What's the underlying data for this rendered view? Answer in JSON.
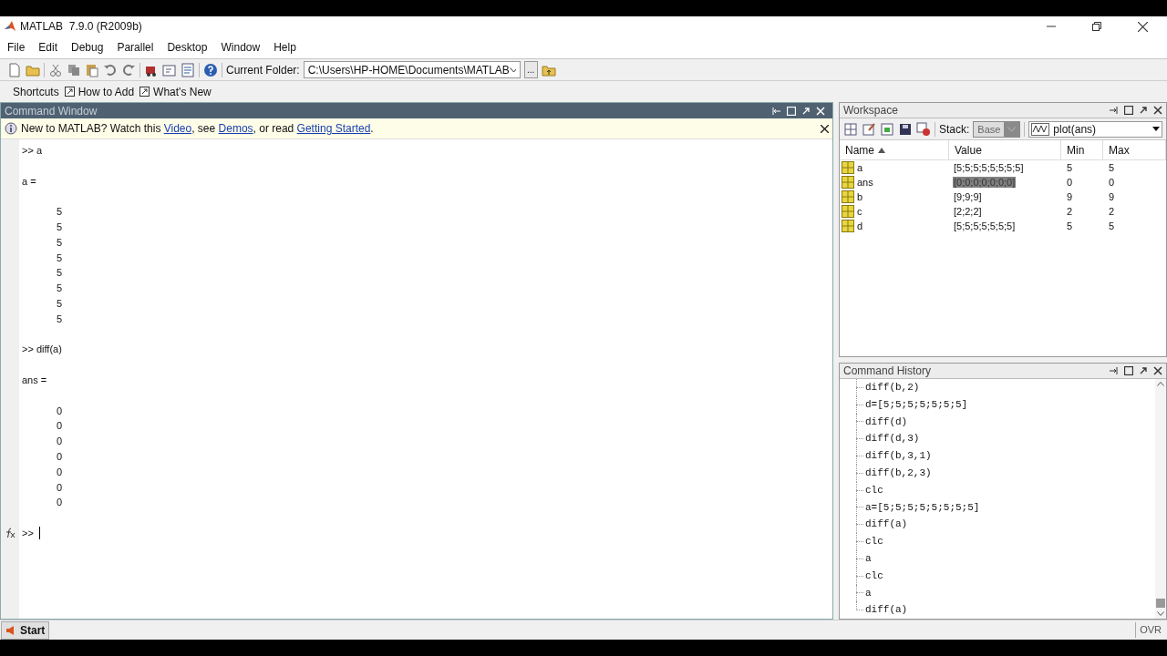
{
  "window": {
    "title": "MATLAB  7.9.0 (R2009b)"
  },
  "menu": [
    "File",
    "Edit",
    "Debug",
    "Parallel",
    "Desktop",
    "Window",
    "Help"
  ],
  "current_folder": {
    "label": "Current Folder:",
    "value": "C:\\Users\\HP-HOME\\Documents\\MATLAB",
    "browse": "..."
  },
  "shortcuts": [
    "Shortcuts",
    "How to Add",
    "What's New"
  ],
  "command_window": {
    "title": "Command Window",
    "banner": [
      {
        "kind": "text",
        "text": "New to MATLAB? Watch this "
      },
      {
        "kind": "link",
        "text": "Video"
      },
      {
        "kind": "text",
        "text": ", see "
      },
      {
        "kind": "link",
        "text": "Demos"
      },
      {
        "kind": "text",
        "text": ", or read "
      },
      {
        "kind": "link",
        "text": "Getting Started"
      },
      {
        "kind": "text",
        "text": "."
      }
    ],
    "lines": [
      {
        "kind": "command",
        "text": ">> a"
      },
      {
        "kind": "label",
        "text": "a ="
      },
      {
        "kind": "value",
        "text": "5"
      },
      {
        "kind": "value",
        "text": "5"
      },
      {
        "kind": "value",
        "text": "5"
      },
      {
        "kind": "value",
        "text": "5"
      },
      {
        "kind": "value",
        "text": "5"
      },
      {
        "kind": "value",
        "text": "5"
      },
      {
        "kind": "value",
        "text": "5"
      },
      {
        "kind": "value",
        "text": "5"
      },
      {
        "kind": "command",
        "text": ">> diff(a)"
      },
      {
        "kind": "label",
        "text": "ans ="
      },
      {
        "kind": "value",
        "text": "0"
      },
      {
        "kind": "value",
        "text": "0"
      },
      {
        "kind": "value",
        "text": "0"
      },
      {
        "kind": "value",
        "text": "0"
      },
      {
        "kind": "value",
        "text": "0"
      },
      {
        "kind": "value",
        "text": "0"
      },
      {
        "kind": "value",
        "text": "0"
      }
    ],
    "prompt": ">>"
  },
  "workspace": {
    "title": "Workspace",
    "stack_label": "Stack:",
    "stack_value": "Base",
    "plot_selector": "plot(ans)",
    "columns": [
      "Name",
      "Value",
      "Min",
      "Max"
    ],
    "rows": [
      {
        "name": "a",
        "value": "[5;5;5;5;5;5;5;5]",
        "min": "5",
        "max": "5",
        "selected": false
      },
      {
        "name": "ans",
        "value": "[0;0;0;0;0;0;0]",
        "min": "0",
        "max": "0",
        "selected": true
      },
      {
        "name": "b",
        "value": "[9;9;9]",
        "min": "9",
        "max": "9",
        "selected": false
      },
      {
        "name": "c",
        "value": "[2;2;2]",
        "min": "2",
        "max": "2",
        "selected": false
      },
      {
        "name": "d",
        "value": "[5;5;5;5;5;5;5]",
        "min": "5",
        "max": "5",
        "selected": false
      }
    ]
  },
  "command_history": {
    "title": "Command History",
    "items": [
      "diff(b,2)",
      "d=[5;5;5;5;5;5;5]",
      "diff(d)",
      "diff(d,3)",
      "diff(b,3,1)",
      "diff(b,2,3)",
      "clc",
      "a=[5;5;5;5;5;5;5;5]",
      "diff(a)",
      "clc",
      "a",
      "clc",
      "a",
      "diff(a)"
    ]
  },
  "status_bar": {
    "start": "Start",
    "mode": "OVR"
  }
}
